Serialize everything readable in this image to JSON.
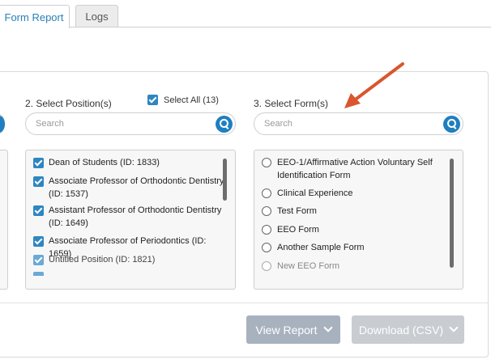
{
  "tabs": [
    {
      "label": "Form Report",
      "active": true
    },
    {
      "label": "Logs",
      "active": false
    }
  ],
  "positions": {
    "label": "2. Select Position(s)",
    "select_all_label": "Select All (13)",
    "select_all_checked": true,
    "search_placeholder": "Search",
    "items": [
      {
        "label": "Dean of Students (ID: 1833)",
        "checked": true
      },
      {
        "label": "Associate Professor of Orthodontic Dentistry (ID: 1537)",
        "checked": true
      },
      {
        "label": "Assistant Professor of Orthodontic Dentistry (ID: 1649)",
        "checked": true
      },
      {
        "label": "Associate Professor of Periodontics (ID: 1659)",
        "checked": true
      },
      {
        "label": "Untitled Position (ID: 1821)",
        "checked": true
      }
    ]
  },
  "forms": {
    "label": "3. Select Form(s)",
    "search_placeholder": "Search",
    "items": [
      {
        "label": "EEO-1/Affirmative Action Voluntary Self Identification Form",
        "selected": false
      },
      {
        "label": "Clinical Experience",
        "selected": false
      },
      {
        "label": "Test Form",
        "selected": false
      },
      {
        "label": "EEO Form",
        "selected": false
      },
      {
        "label": "Another Sample Form",
        "selected": false
      },
      {
        "label": "New EEO Form",
        "selected": false
      }
    ]
  },
  "actions": {
    "view_report": "View Report",
    "download": "Download (CSV)"
  },
  "colors": {
    "accent": "#1f7fc0",
    "annotation_arrow": "#d9562e"
  }
}
